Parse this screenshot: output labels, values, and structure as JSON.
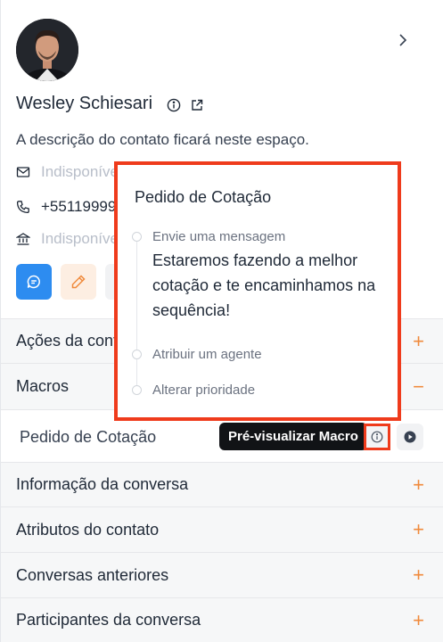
{
  "contact": {
    "name": "Wesley Schiesari",
    "description": "A descrição do contato ficará neste espaço.",
    "email": "Indisponível",
    "phone": "+5511999999999",
    "company": "Indisponível"
  },
  "sections": {
    "acoes": "Ações da conversa",
    "macros": "Macros",
    "info": "Informação da conversa",
    "atributos": "Atributos do contato",
    "anteriores": "Conversas anteriores",
    "participantes": "Participantes da conversa"
  },
  "macro": {
    "name": "Pedido de Cotação",
    "tooltip": "Pré-visualizar Macro"
  },
  "preview": {
    "title": "Pedido de Cotação",
    "steps": [
      {
        "label": "Envie uma mensagem",
        "message": "Estaremos fazendo a melhor cotação e te encaminhamos na sequência!"
      },
      {
        "label": "Atribuir um agente"
      },
      {
        "label": "Alterar prioridade"
      }
    ]
  },
  "icons": {
    "chevron": "chevron-right-icon",
    "info": "info-icon",
    "external": "external-link-icon",
    "mail": "mail-icon",
    "phone": "phone-icon",
    "company": "building-icon",
    "message": "message-icon",
    "edit": "pencil-icon",
    "play": "play-icon"
  },
  "colors": {
    "accent_orange": "#f08a3c",
    "primary_blue": "#2d8cf0",
    "highlight_red": "#ef3b1c"
  }
}
